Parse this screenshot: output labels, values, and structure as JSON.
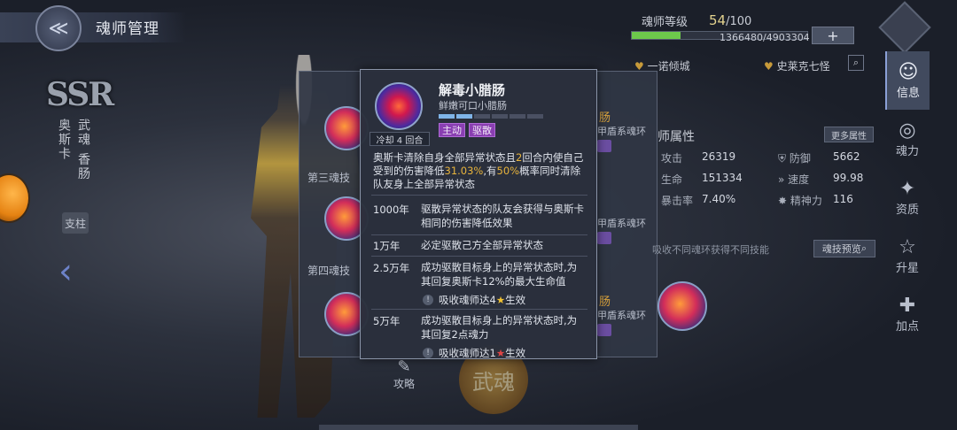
{
  "header": {
    "title": "魂师管理",
    "back_icon": "back-arrow-icon"
  },
  "hero": {
    "rarity": "SSR",
    "name_vertical": "奥斯卡",
    "spirit_vertical": "武魂 香肠",
    "role_tag": "支柱"
  },
  "skills": [
    {
      "label": "",
      "ring": ""
    },
    {
      "label": "第三魂技",
      "ring": "甲盾系魂环"
    },
    {
      "label": "第四魂技",
      "ring": "甲盾系魂环"
    },
    {
      "label": "",
      "ring": "甲盾系魂环"
    }
  ],
  "skill_partial_texts": {
    "orange1": "肠",
    "orange2": "肠",
    "orange3": "肠",
    "attr": "师属性"
  },
  "level": {
    "label": "魂师等级",
    "current": "54",
    "max": "/100",
    "xp": "1366480/4903304",
    "xp_fraction": 0.28,
    "plus": "+"
  },
  "factions": [
    {
      "name": "一诺倾城"
    },
    {
      "name": "史莱克七怪"
    }
  ],
  "stats": {
    "more_label": "更多属性",
    "items": [
      {
        "label": "攻击",
        "value": "26319"
      },
      {
        "label": "防御",
        "value": "5662"
      },
      {
        "label": "生命",
        "value": "151334"
      },
      {
        "label": "速度",
        "value": "99.98"
      },
      {
        "label": "暴击率",
        "value": "7.40%"
      },
      {
        "label": "精神力",
        "value": "116"
      }
    ]
  },
  "skill_preview": {
    "hint": "吸收不同魂环获得不同技能",
    "button": "魂技预览"
  },
  "nav": [
    {
      "label": "信息",
      "active": true
    },
    {
      "label": "魂力",
      "active": false
    },
    {
      "label": "资质",
      "active": false
    },
    {
      "label": "升星",
      "active": false
    },
    {
      "label": "加点",
      "active": false
    }
  ],
  "bottom": {
    "strategy": "攻略",
    "wuhun": "武魂"
  },
  "tooltip": {
    "name": "解毒小腊肠",
    "subtitle": "鲜嫩可口小腊肠",
    "cooldown": "冷却 4 回合",
    "tags": [
      "主动",
      "驱散"
    ],
    "segments_on": 2,
    "segments_total": 6,
    "desc_parts": [
      "奥斯卡清除自身全部异常状态且",
      "2",
      "回合内使自己受到的伤害降低",
      "31.03%",
      ",有",
      "50%",
      "概率同时清除队友身上全部异常状态"
    ],
    "upgrades": [
      {
        "year": "1000年",
        "text": "驱散异常状态的队友会获得与奥斯卡相同的伤害降低效果"
      },
      {
        "year": "1万年",
        "text": "必定驱散己方全部异常状态"
      },
      {
        "year": "2.5万年",
        "text": "成功驱散目标身上的异常状态时,为其回复奥斯卡12%的最大生命值",
        "condition": "吸收魂师达4",
        "cond_suffix": "生效"
      },
      {
        "year": "5万年",
        "text": "成功驱散目标身上的异常状态时,为其回复2点魂力",
        "condition": "吸收魂师达1",
        "cond_suffix": "生效"
      }
    ]
  }
}
